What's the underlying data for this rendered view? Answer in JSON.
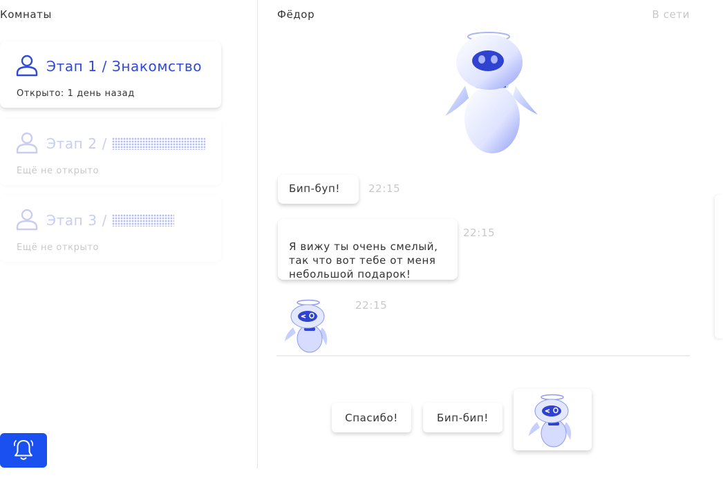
{
  "sidebar": {
    "title": "Комнаты",
    "rooms": [
      {
        "prefix": "Этап 1 / ",
        "name": "Знакомство",
        "status": "Открыто: 1 день назад",
        "state": "open"
      },
      {
        "prefix": "Этап 2 / ",
        "name": "",
        "status": "Ещё не открыто",
        "state": "locked"
      },
      {
        "prefix": "Этап 3 / ",
        "name": "",
        "status": "Ещё не открыто",
        "state": "locked"
      }
    ],
    "bell_icon": "bell-icon"
  },
  "chat": {
    "contact_name": "Фёдор",
    "contact_status": "В сети",
    "messages": [
      {
        "text": "Бип-буп!",
        "time": "22:15"
      },
      {
        "text": "Я вижу ты очень смелый,\nтак что вот тебе от меня\nнебольшой подарок!",
        "time": "22:15"
      },
      {
        "sticker": "robot-sticker",
        "time": "22:15"
      }
    ],
    "quick_replies": [
      "Спасибо!",
      "Бип-бип!"
    ],
    "sticker_reply": "robot-sticker"
  },
  "colors": {
    "accent": "#2f4ad6",
    "button": "#1a4ff0",
    "muted": "#c8c8c8"
  }
}
